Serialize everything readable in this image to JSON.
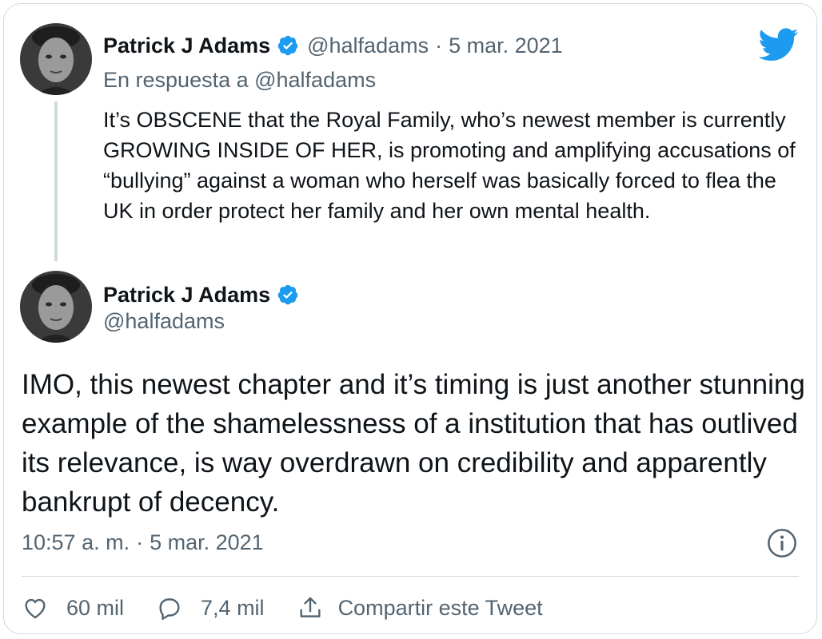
{
  "parent_tweet": {
    "author_name": "Patrick J Adams",
    "handle": "@halfadams",
    "separator": "·",
    "date": "5 mar. 2021",
    "reply_to": "En respuesta a @halfadams",
    "text": "It’s OBSCENE that the Royal Family, who’s newest member is currently GROWING INSIDE OF HER, is promoting and amplifying accusations of “bullying” against a woman who herself was basically forced to flea the UK in order protect her family and her own mental health."
  },
  "main_tweet": {
    "author_name": "Patrick J Adams",
    "handle": "@halfadams",
    "text": "IMO, this newest chapter and it’s timing is just another stunning example of the shamelessness of a institution that has outlived its relevance, is way overdrawn on credibility and apparently bankrupt of decency.",
    "time": "10:57 a. m.",
    "separator": "·",
    "date": "5 mar. 2021"
  },
  "actions": {
    "likes": "60 mil",
    "replies": "7,4 mil",
    "share_label": "Compartir este Tweet"
  },
  "icons": {
    "brand": "twitter-bird-icon",
    "verified": "verified-badge-icon",
    "info": "info-icon",
    "like": "heart-icon",
    "reply": "reply-bubble-icon",
    "share": "share-icon"
  },
  "colors": {
    "twitter_blue": "#1d9bf0",
    "text_primary": "#0f1419",
    "text_secondary": "#536471",
    "border": "#cfd9de"
  }
}
